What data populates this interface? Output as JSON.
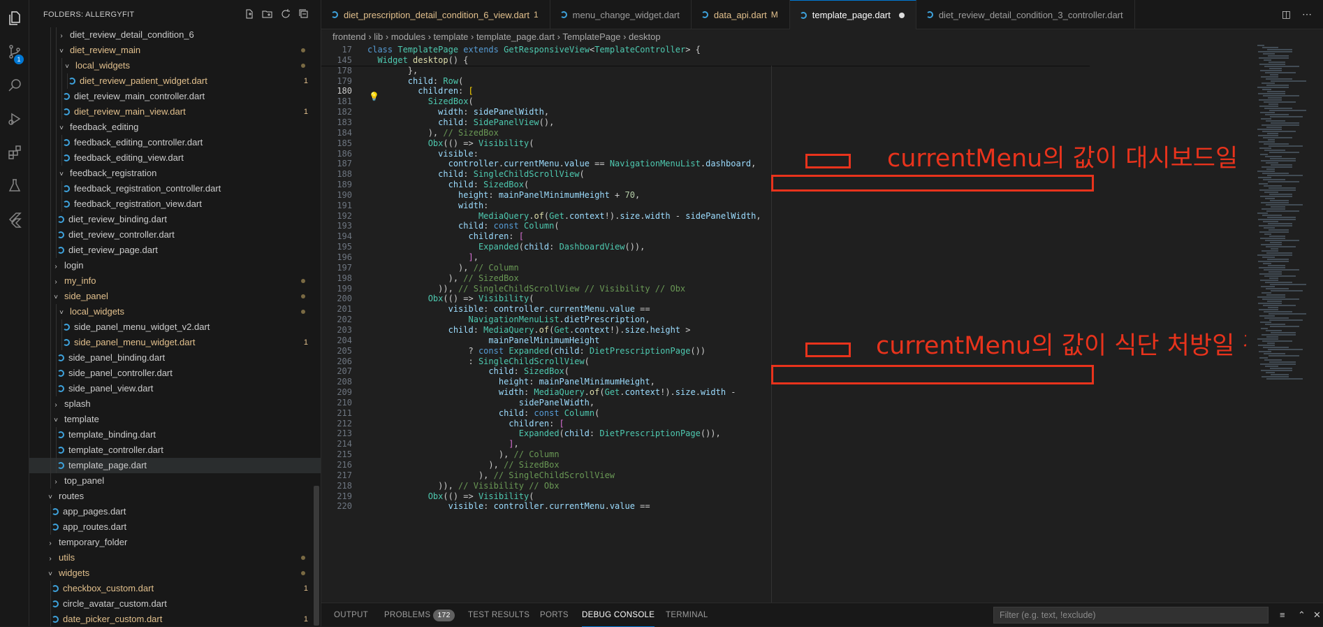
{
  "explorer": {
    "title": "FOLDERS: ALLERGYFIT",
    "scm_badge": "1",
    "items": [
      {
        "label": "diet_review_detail_condition_6",
        "type": "folder-closed",
        "indent": 2
      },
      {
        "label": "diet_review_main",
        "type": "folder-open",
        "indent": 2,
        "modified": true,
        "dot": true
      },
      {
        "label": "local_widgets",
        "type": "folder-open",
        "indent": 3,
        "modified": true,
        "dot": true
      },
      {
        "label": "diet_review_patient_widget.dart",
        "type": "file",
        "indent": 4,
        "modified": true,
        "count": "1",
        "selected_light": true
      },
      {
        "label": "diet_review_main_controller.dart",
        "type": "file",
        "indent": 3
      },
      {
        "label": "diet_review_main_view.dart",
        "type": "file",
        "indent": 3,
        "modified": true,
        "count": "1"
      },
      {
        "label": "feedback_editing",
        "type": "folder-open",
        "indent": 2
      },
      {
        "label": "feedback_editing_controller.dart",
        "type": "file",
        "indent": 3
      },
      {
        "label": "feedback_editing_view.dart",
        "type": "file",
        "indent": 3
      },
      {
        "label": "feedback_registration",
        "type": "folder-open",
        "indent": 2
      },
      {
        "label": "feedback_registration_controller.dart",
        "type": "file",
        "indent": 3
      },
      {
        "label": "feedback_registration_view.dart",
        "type": "file",
        "indent": 3
      },
      {
        "label": "diet_review_binding.dart",
        "type": "file",
        "indent": 2
      },
      {
        "label": "diet_review_controller.dart",
        "type": "file",
        "indent": 2
      },
      {
        "label": "diet_review_page.dart",
        "type": "file",
        "indent": 2
      },
      {
        "label": "login",
        "type": "folder-closed",
        "indent": 1
      },
      {
        "label": "my_info",
        "type": "folder-closed",
        "indent": 1,
        "modified": true,
        "dot": true
      },
      {
        "label": "side_panel",
        "type": "folder-open",
        "indent": 1,
        "modified": true,
        "dot": true
      },
      {
        "label": "local_widgets",
        "type": "folder-open",
        "indent": 2,
        "modified": true,
        "dot": true
      },
      {
        "label": "side_panel_menu_widget_v2.dart",
        "type": "file",
        "indent": 3
      },
      {
        "label": "side_panel_menu_widget.dart",
        "type": "file",
        "indent": 3,
        "modified": true,
        "count": "1"
      },
      {
        "label": "side_panel_binding.dart",
        "type": "file",
        "indent": 2
      },
      {
        "label": "side_panel_controller.dart",
        "type": "file",
        "indent": 2
      },
      {
        "label": "side_panel_view.dart",
        "type": "file",
        "indent": 2
      },
      {
        "label": "splash",
        "type": "folder-closed",
        "indent": 1
      },
      {
        "label": "template",
        "type": "folder-open",
        "indent": 1
      },
      {
        "label": "template_binding.dart",
        "type": "file",
        "indent": 2
      },
      {
        "label": "template_controller.dart",
        "type": "file",
        "indent": 2
      },
      {
        "label": "template_page.dart",
        "type": "file",
        "indent": 2,
        "selected": true
      },
      {
        "label": "top_panel",
        "type": "folder-closed",
        "indent": 1
      },
      {
        "label": "routes",
        "type": "folder-open",
        "indent": 0
      },
      {
        "label": "app_pages.dart",
        "type": "file",
        "indent": 1
      },
      {
        "label": "app_routes.dart",
        "type": "file",
        "indent": 1
      },
      {
        "label": "temporary_folder",
        "type": "folder-closed",
        "indent": 0
      },
      {
        "label": "utils",
        "type": "folder-closed",
        "indent": 0,
        "modified": true,
        "dot": true
      },
      {
        "label": "widgets",
        "type": "folder-open",
        "indent": 0,
        "modified": true,
        "dot": true
      },
      {
        "label": "checkbox_custom.dart",
        "type": "file",
        "indent": 1,
        "modified": true,
        "count": "1"
      },
      {
        "label": "circle_avatar_custom.dart",
        "type": "file",
        "indent": 1
      },
      {
        "label": "date_picker_custom.dart",
        "type": "file",
        "indent": 1,
        "modified": true,
        "count": "1"
      }
    ]
  },
  "tabs": [
    {
      "label": "diet_prescription_detail_condition_6_view.dart",
      "decoration": "1",
      "modified": true
    },
    {
      "label": "menu_change_widget.dart"
    },
    {
      "label": "data_api.dart",
      "decoration": "M",
      "modified": true
    },
    {
      "label": "template_page.dart",
      "active": true,
      "unsaved": true
    },
    {
      "label": "diet_review_detail_condition_3_controller.dart"
    }
  ],
  "breadcrumb": [
    "frontend",
    "lib",
    "modules",
    "template",
    "template_page.dart",
    "TemplatePage",
    "desktop"
  ],
  "editor": {
    "current_line": "180",
    "lines": [
      {
        "n": "17",
        "html": "<span class='k'>class</span> <span class='t'>TemplatePage</span> <span class='k'>extends</span> <span class='t'>GetResponsiveView</span>&lt;<span class='t'>TemplateController</span>&gt; {"
      },
      {
        "n": "145",
        "html": "  <span class='t'>Widget</span> <span class='f'>desktop</span>() {"
      },
      {
        "n": "178",
        "html": "        },"
      },
      {
        "n": "179",
        "html": "        <span class='v'>child</span>: <span class='t'>Row</span>("
      },
      {
        "n": "180",
        "html": "          <span class='v'>children</span>: <span class='y'>[</span>"
      },
      {
        "n": "181",
        "html": "            <span class='t'>SizedBox</span>("
      },
      {
        "n": "182",
        "html": "              <span class='v'>width</span>: <span class='v'>sidePanelWidth</span>,"
      },
      {
        "n": "183",
        "html": "              <span class='v'>child</span>: <span class='t'>SidePanelView</span>(),"
      },
      {
        "n": "184",
        "html": "            ), <span class='c'>// SizedBox</span>"
      },
      {
        "n": "185",
        "html": "            <span class='t'>Obx</span>(() => <span class='t'>Visibility</span>("
      },
      {
        "n": "186",
        "html": "              <span class='v'>visible</span>:"
      },
      {
        "n": "187",
        "html": "                <span class='v'>controller</span>.<span class='v'>currentMenu</span>.<span class='v'>value</span> == <span class='t'>NavigationMenuList</span>.<span class='v'>dashboard</span>,"
      },
      {
        "n": "188",
        "html": "              <span class='v'>child</span>: <span class='t'>SingleChildScrollView</span>("
      },
      {
        "n": "189",
        "html": "                <span class='v'>child</span>: <span class='t'>SizedBox</span>("
      },
      {
        "n": "190",
        "html": "                  <span class='v'>height</span>: <span class='v'>mainPanelMinimumHeight</span> + <span class='n'>70</span>,"
      },
      {
        "n": "191",
        "html": "                  <span class='v'>width</span>:"
      },
      {
        "n": "192",
        "html": "                      <span class='t'>MediaQuery</span>.<span class='f'>of</span>(<span class='t'>Get</span>.<span class='v'>context</span>!).<span class='v'>size</span>.<span class='v'>width</span> - <span class='v'>sidePanelWidth</span>,"
      },
      {
        "n": "193",
        "html": "                  <span class='v'>child</span>: <span class='k'>const</span> <span class='t'>Column</span>("
      },
      {
        "n": "194",
        "html": "                    <span class='v'>children</span>: <span class='p'>[</span>"
      },
      {
        "n": "195",
        "html": "                      <span class='t'>Expanded</span>(<span class='v'>child</span>: <span class='t'>DashboardView</span>()),"
      },
      {
        "n": "196",
        "html": "                    <span class='p'>]</span>,"
      },
      {
        "n": "197",
        "html": "                  ), <span class='c'>// Column</span>"
      },
      {
        "n": "198",
        "html": "                ), <span class='c'>// SizedBox</span>"
      },
      {
        "n": "199",
        "html": "              )), <span class='c'>// SingleChildScrollView // Visibility // Obx</span>"
      },
      {
        "n": "200",
        "html": "            <span class='t'>Obx</span>(() => <span class='t'>Visibility</span>("
      },
      {
        "n": "201",
        "html": "                <span class='v'>visible</span>: <span class='v'>controller</span>.<span class='v'>currentMenu</span>.<span class='v'>value</span> =="
      },
      {
        "n": "202",
        "html": "                    <span class='t'>NavigationMenuList</span>.<span class='v'>dietPrescription</span>,"
      },
      {
        "n": "203",
        "html": "                <span class='v'>child</span>: <span class='t'>MediaQuery</span>.<span class='f'>of</span>(<span class='t'>Get</span>.<span class='v'>context</span>!).<span class='v'>size</span>.<span class='v'>height</span> &gt;"
      },
      {
        "n": "204",
        "html": "                        <span class='v'>mainPanelMinimumHeight</span>"
      },
      {
        "n": "205",
        "html": "                    ? <span class='k'>const</span> <span class='t'>Expanded</span>(<span class='v'>child</span>: <span class='t'>DietPrescriptionPage</span>())"
      },
      {
        "n": "206",
        "html": "                    : <span class='t'>SingleChildScrollView</span>("
      },
      {
        "n": "207",
        "html": "                        <span class='v'>child</span>: <span class='t'>SizedBox</span>("
      },
      {
        "n": "208",
        "html": "                          <span class='v'>height</span>: <span class='v'>mainPanelMinimumHeight</span>,"
      },
      {
        "n": "209",
        "html": "                          <span class='v'>width</span>: <span class='t'>MediaQuery</span>.<span class='f'>of</span>(<span class='t'>Get</span>.<span class='v'>context</span>!).<span class='v'>size</span>.<span class='v'>width</span> -"
      },
      {
        "n": "210",
        "html": "                              <span class='v'>sidePanelWidth</span>,"
      },
      {
        "n": "211",
        "html": "                          <span class='v'>child</span>: <span class='k'>const</span> <span class='t'>Column</span>("
      },
      {
        "n": "212",
        "html": "                            <span class='v'>children</span>: <span class='p'>[</span>"
      },
      {
        "n": "213",
        "html": "                              <span class='t'>Expanded</span>(<span class='v'>child</span>: <span class='t'>DietPrescriptionPage</span>()),"
      },
      {
        "n": "214",
        "html": "                            <span class='p'>]</span>,"
      },
      {
        "n": "215",
        "html": "                          ), <span class='c'>// Column</span>"
      },
      {
        "n": "216",
        "html": "                        ), <span class='c'>// SizedBox</span>"
      },
      {
        "n": "217",
        "html": "                      ), <span class='c'>// SingleChildScrollView</span>"
      },
      {
        "n": "218",
        "html": "              )), <span class='c'>// Visibility // Obx</span>"
      },
      {
        "n": "219",
        "html": "            <span class='t'>Obx</span>(() => <span class='t'>Visibility</span>("
      },
      {
        "n": "220",
        "html": "                <span class='v'>visible</span>: <span class='v'>controller</span>.<span class='v'>currentMenu</span>.<span class='v'>value</span> =="
      }
    ]
  },
  "annotations": {
    "note1": "currentMenu의 값이 대시보드일 경우 대시보드 화면을 보여주기",
    "note2": "currentMenu의 값이 식단 처방일 경우 식단 처방 화면을 보여주기"
  },
  "panel": {
    "tabs": [
      "OUTPUT",
      "PROBLEMS",
      "TEST RESULTS",
      "PORTS",
      "DEBUG CONSOLE",
      "TERMINAL"
    ],
    "problems_count": "172",
    "active_tab": "DEBUG CONSOLE",
    "filter_placeholder": "Filter (e.g. text, !exclude)"
  },
  "colors": {
    "accent": "#0078d4",
    "annotation": "#e8331c",
    "modified": "#e2c08d"
  }
}
